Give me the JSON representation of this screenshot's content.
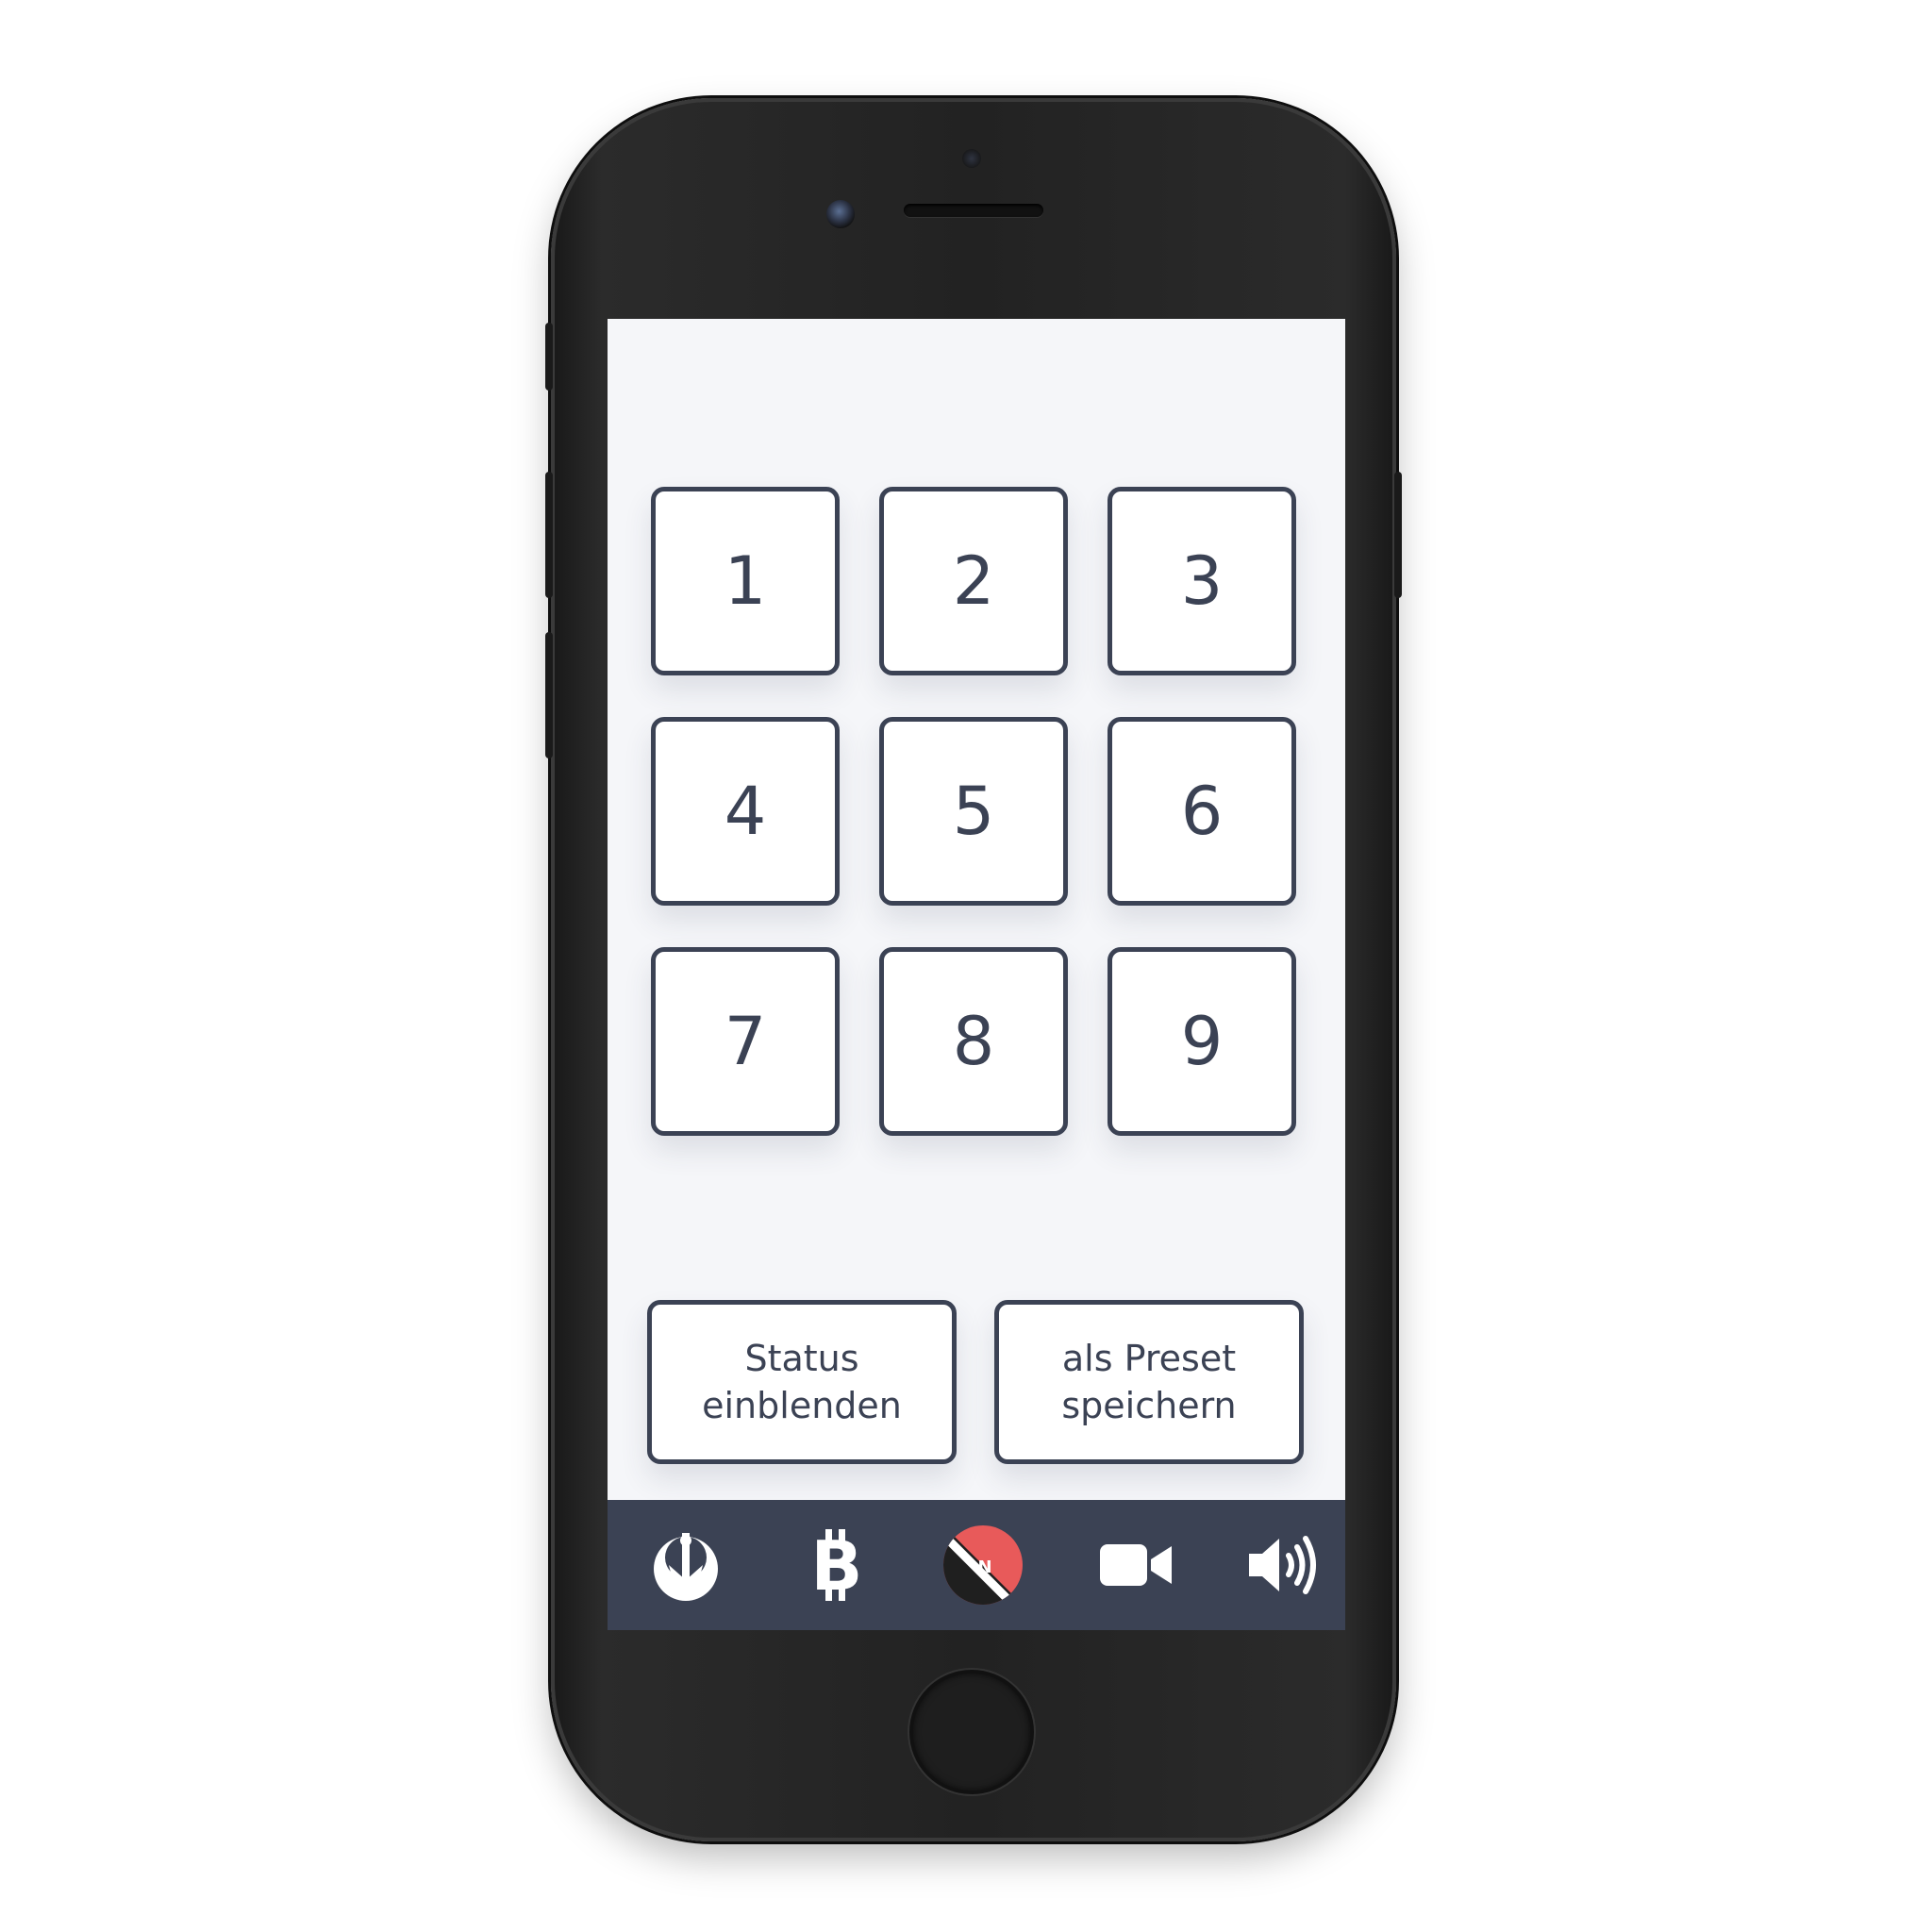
{
  "keypad": {
    "keys": [
      {
        "label": "1"
      },
      {
        "label": "2"
      },
      {
        "label": "3"
      },
      {
        "label": "4"
      },
      {
        "label": "5"
      },
      {
        "label": "6"
      },
      {
        "label": "7"
      },
      {
        "label": "8"
      },
      {
        "label": "9"
      }
    ]
  },
  "actions": {
    "status": {
      "line1": "Status",
      "line2": "einblenden"
    },
    "preset": {
      "line1": "als Preset",
      "line2": "speichern"
    }
  },
  "tabbar": {
    "items": [
      {
        "icon": "rebel-alliance-icon"
      },
      {
        "icon": "bitcoin-icon"
      },
      {
        "icon": "no-entry-icon"
      },
      {
        "icon": "video-camera-icon"
      },
      {
        "icon": "volume-high-icon"
      }
    ]
  },
  "colors": {
    "accent": "#3b4254",
    "screen_background": "#f5f6f9",
    "tabbar_background": "#3b4254",
    "icon_white": "#ffffff",
    "icon_red": "#e85a5a"
  }
}
